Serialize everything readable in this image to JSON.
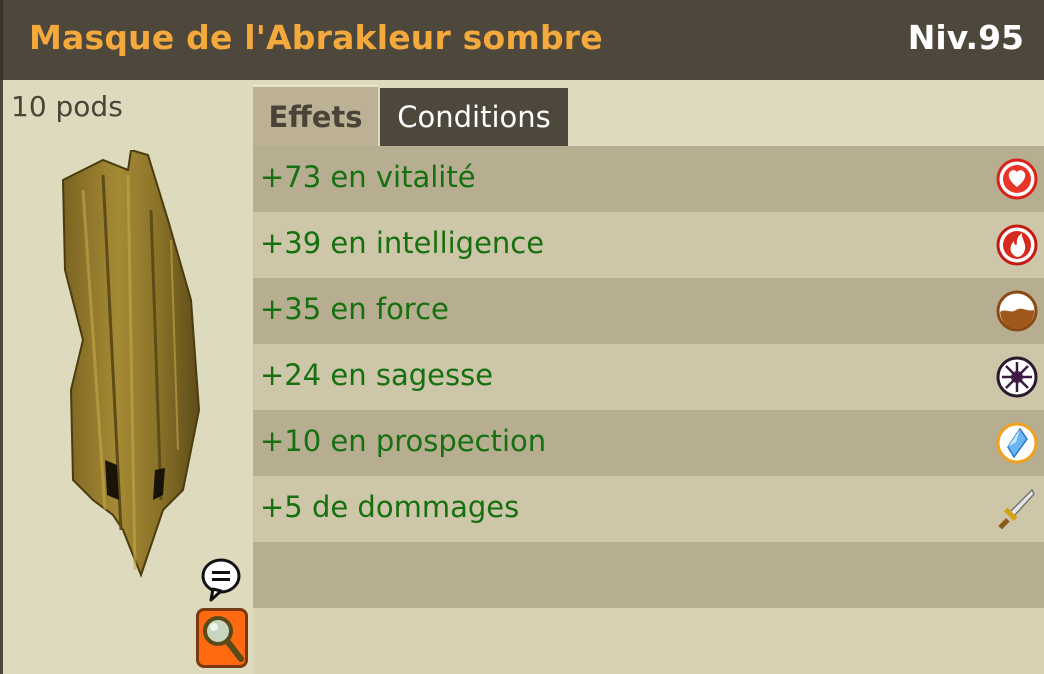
{
  "item": {
    "name": "Masque de l'Abrakleur sombre",
    "level": "Niv.95",
    "weight": "10 pods"
  },
  "tabs": [
    {
      "label": "Effets",
      "active": true
    },
    {
      "label": "Conditions",
      "active": false
    }
  ],
  "effects": [
    {
      "text": "+73 en vitalité",
      "icon": "heart-icon"
    },
    {
      "text": "+39 en intelligence",
      "icon": "fire-icon"
    },
    {
      "text": "+35 en force",
      "icon": "earth-icon"
    },
    {
      "text": "+24 en sagesse",
      "icon": "wisdom-icon"
    },
    {
      "text": "+10 en prospection",
      "icon": "crystal-icon"
    },
    {
      "text": "+5 de dommages",
      "icon": "sword-icon"
    }
  ],
  "colors": {
    "title": "#f3a93b",
    "effect_text": "#16700f",
    "header_bg": "#4e473c"
  }
}
